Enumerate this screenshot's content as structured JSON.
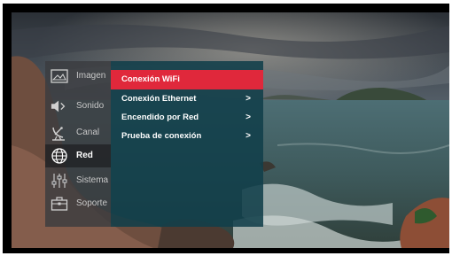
{
  "menu": {
    "categories": [
      {
        "label": "Imagen",
        "icon": "picture-icon",
        "active": false
      },
      {
        "label": "Sonido",
        "icon": "speaker-icon",
        "active": false
      },
      {
        "label": "Canal",
        "icon": "satellite-dish-icon",
        "active": false
      },
      {
        "label": "Red",
        "icon": "globe-icon",
        "active": true
      },
      {
        "label": "Sistema",
        "icon": "sliders-icon",
        "active": false
      },
      {
        "label": "Soporte",
        "icon": "toolbox-icon",
        "active": false
      }
    ],
    "network_items": [
      {
        "label": "Conexión WiFi",
        "arrow": "",
        "selected": true
      },
      {
        "label": "Conexión Ethernet",
        "arrow": ">",
        "selected": false
      },
      {
        "label": "Encendido por Red",
        "arrow": ">",
        "selected": false
      },
      {
        "label": "Prueba de conexión",
        "arrow": ">",
        "selected": false
      }
    ]
  },
  "colors": {
    "highlight": "#e0283b",
    "submenu_bg": "#113f4a",
    "category_bg": "#3a3c40"
  }
}
